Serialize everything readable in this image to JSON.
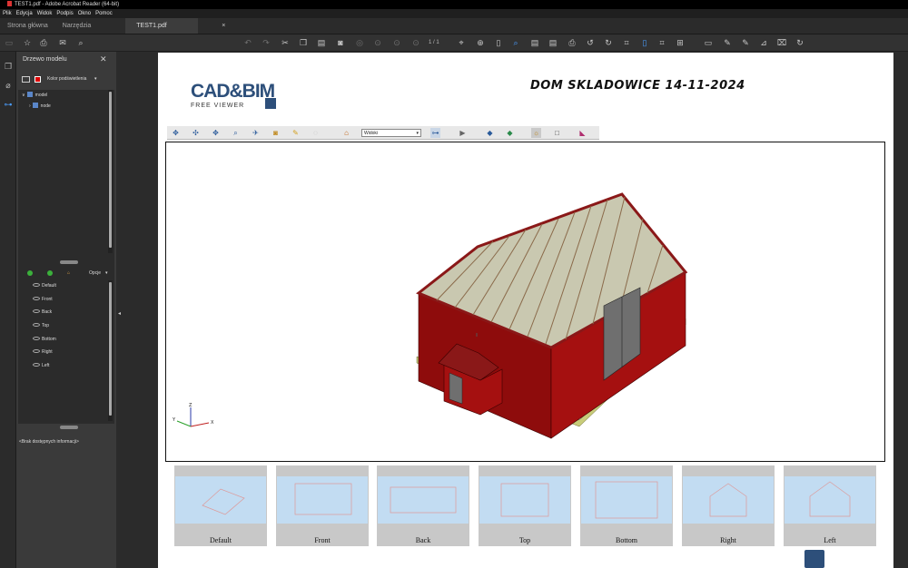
{
  "window": {
    "title": "TEST1.pdf - Adobe Acrobat Reader (64-bit)"
  },
  "menu": [
    "Plik",
    "Edycja",
    "Widok",
    "Podpis",
    "Okno",
    "Pomoc"
  ],
  "tabs": {
    "home": "Strona główna",
    "tools": "Narzędzia",
    "document": "TEST1.pdf",
    "close": "×"
  },
  "toolbar": {
    "page_current": "1",
    "page_total": "/ 1"
  },
  "model_panel": {
    "title": "Drzewo modelu",
    "close": "✕",
    "highlight_color_label": "Kolor podświetlenia",
    "highlight_color": "#dd0000",
    "tree": [
      {
        "label": "model"
      },
      {
        "label": "node"
      }
    ],
    "views_options": "Opcje",
    "views": [
      "Default",
      "Front",
      "Back",
      "Top",
      "Bottom",
      "Right",
      "Left"
    ],
    "info": "<Brak dostępnych informacji>"
  },
  "document": {
    "logo_main": "CAD&BIM",
    "logo_sub": "FREE VIEWER",
    "title": "DOM SKLADOWICE 14-11-2024",
    "views_select": "Widoki",
    "axis_labels": [
      "Z",
      "X",
      "Y"
    ],
    "thumbnails": [
      "Default",
      "Front",
      "Back",
      "Top",
      "Bottom",
      "Right",
      "Left"
    ]
  },
  "colors": {
    "wall": "#a51010",
    "roof_frame": "#8a1818",
    "slab": "#c8cc7a",
    "door": "#6f6f6f",
    "roof_fill": "#c9c8b0"
  }
}
